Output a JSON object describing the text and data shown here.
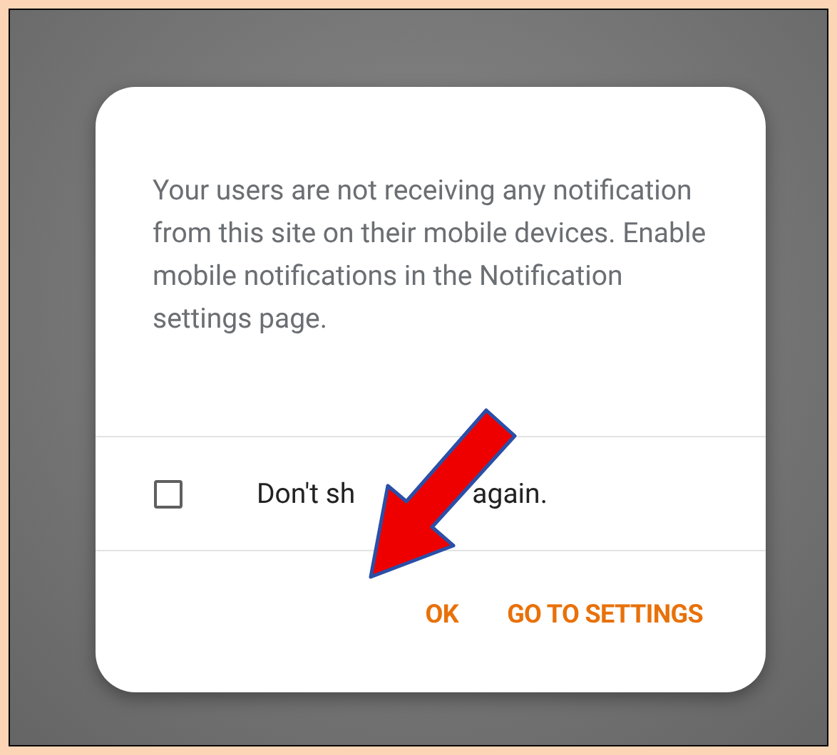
{
  "dialog": {
    "message": "Your users are not receiving any notification from this site on their mobile devices. Enable mobile notifications in the Notification settings page.",
    "checkbox": {
      "checked": false,
      "label_parts": [
        "Don't sh",
        "again."
      ]
    },
    "buttons": [
      {
        "label": "OK"
      },
      {
        "label": "GO TO SETTINGS"
      }
    ]
  }
}
